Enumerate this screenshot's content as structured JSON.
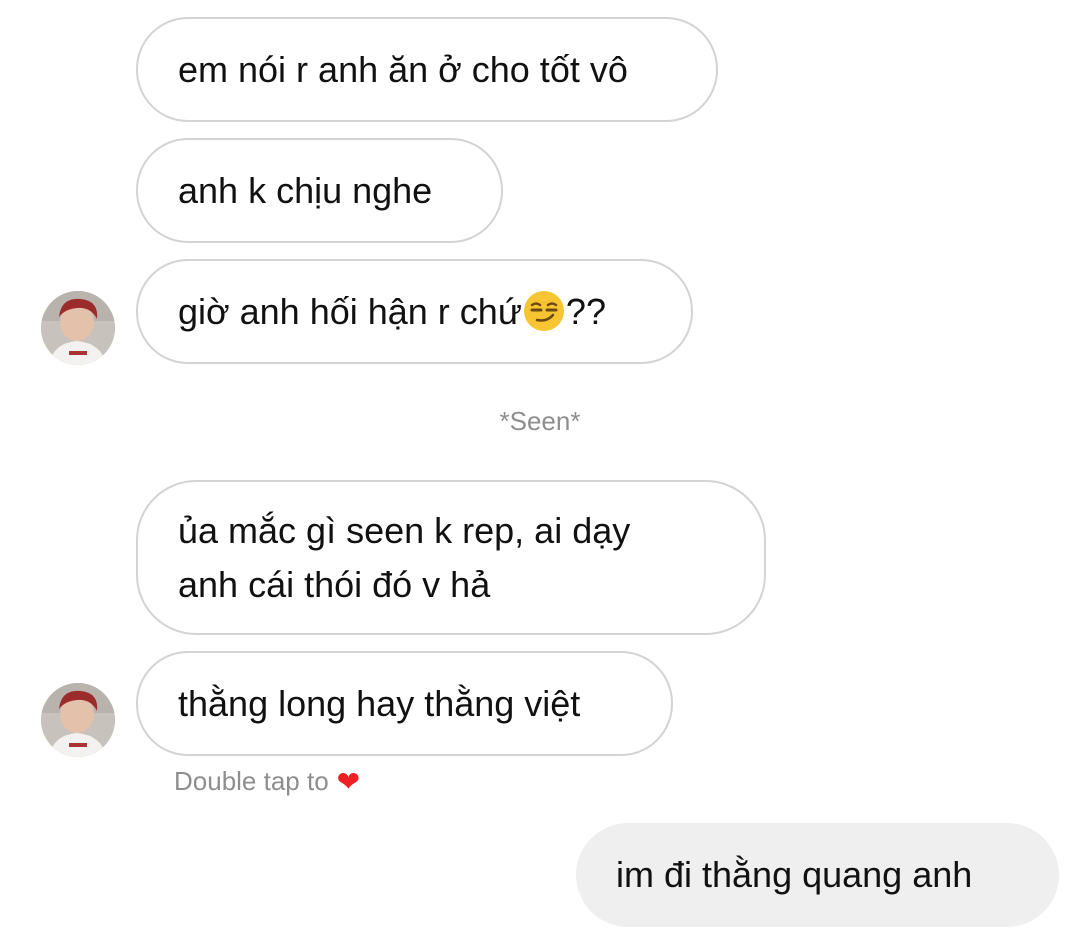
{
  "messages": [
    {
      "sender": "other",
      "text": "em nói r anh ăn ở cho tốt vô"
    },
    {
      "sender": "other",
      "text": "anh k chịu nghe"
    },
    {
      "sender": "other",
      "text_before": "giờ anh hối hận r chứ",
      "emoji": "smirking-face",
      "text_after": "??"
    },
    {
      "sender": "other",
      "lines": [
        "ủa mắc gì seen k rep, ai dạy",
        "anh cái thói đó v hả"
      ]
    },
    {
      "sender": "other",
      "text": "thằng long hay thằng việt"
    },
    {
      "sender": "me",
      "text": "im đi thằng quang anh"
    }
  ],
  "status": {
    "seen_text": "*Seen*",
    "double_tap_text": "Double tap to",
    "heart_symbol": "❤"
  },
  "colors": {
    "bubble_border": "#d3d3d3",
    "my_bubble_bg": "#efefef",
    "meta_text": "#8e8e8e",
    "heart": "#ed2024"
  }
}
